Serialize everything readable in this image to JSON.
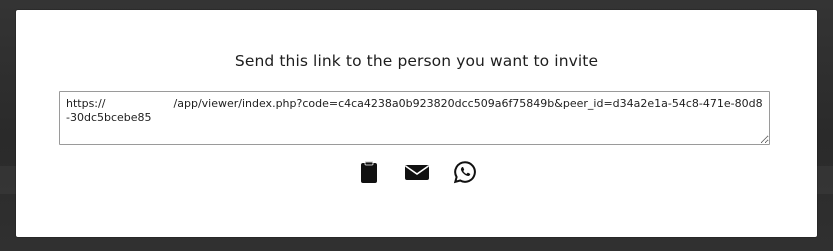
{
  "modal": {
    "title": "Send this link to the person you want to invite",
    "link": "https://                               /app/viewer/index.php?code=c4ca4238a0b923820dcc509a6f75849b&peer_id=d34a2e1a-54c8-471e-80d8-30dc5bcebe85"
  },
  "actions": [
    {
      "name": "copy-to-clipboard",
      "icon": "clipboard-icon"
    },
    {
      "name": "share-email",
      "icon": "envelope-icon"
    },
    {
      "name": "share-whatsapp",
      "icon": "whatsapp-icon"
    }
  ],
  "colors": {
    "backdrop": "#2f2f2f",
    "modal_bg": "#ffffff",
    "text": "#1e1e1e",
    "icon": "#111111"
  }
}
